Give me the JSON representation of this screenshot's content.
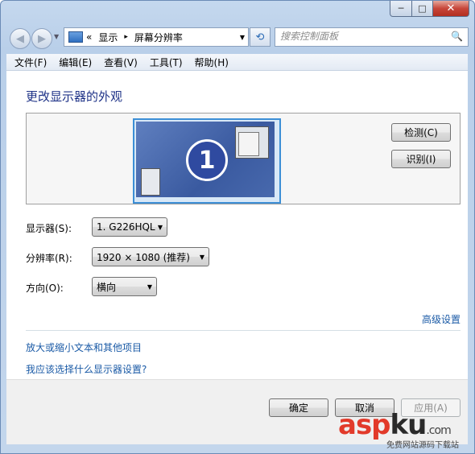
{
  "window": {
    "title": ""
  },
  "caption_buttons": {
    "minimize": "─",
    "maximize": "□",
    "close": "✕"
  },
  "nav": {
    "back_icon": "◀",
    "forward_icon": "▶",
    "dropdown_icon": "▼",
    "address": {
      "prefix": "«",
      "segments": [
        "显示",
        "屏幕分辨率"
      ],
      "separator": "▸",
      "dropdown": "▼"
    },
    "refresh_icon": "⟲",
    "search": {
      "placeholder": "搜索控制面板",
      "icon": "🔍"
    }
  },
  "menu": [
    "文件(F)",
    "编辑(E)",
    "查看(V)",
    "工具(T)",
    "帮助(H)"
  ],
  "main": {
    "heading": "更改显示器的外观",
    "monitor_number": "1",
    "buttons": {
      "detect": "检测(C)",
      "identify": "识别(I)"
    },
    "fields": [
      {
        "label": "显示器(S):",
        "value": "1. G226HQL"
      },
      {
        "label": "分辨率(R):",
        "value": "1920 × 1080 (推荐)"
      },
      {
        "label": "方向(O):",
        "value": "横向"
      }
    ],
    "advanced_link": "高级设置",
    "links": [
      "放大或缩小文本和其他项目",
      "我应该选择什么显示器设置?"
    ]
  },
  "footer": {
    "ok": "确定",
    "cancel": "取消",
    "apply": "应用(A)"
  },
  "watermark": {
    "asp": "asp",
    "ku": "ku",
    "com": ".com",
    "sub": "免费网站源码下载站"
  }
}
